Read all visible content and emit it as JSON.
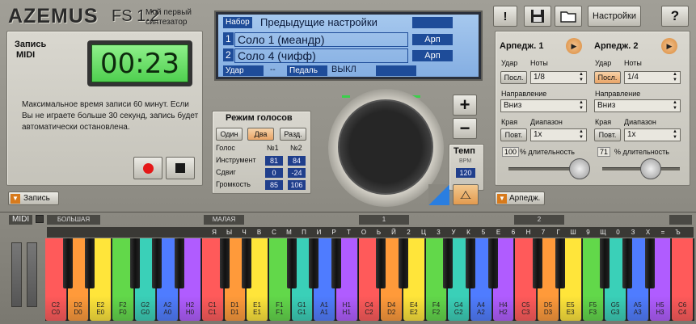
{
  "header": {
    "logo": "AZEMUS",
    "version": "FS 1.2",
    "subtitle": "Мой первый синтезатор"
  },
  "toolbar": {
    "help_label": "!",
    "settings_label": "Настройки",
    "question_label": "?",
    "save_icon": "floppy-icon",
    "folder_icon": "folder-icon"
  },
  "recording": {
    "title_line1": "Запись",
    "title_line2": "MIDI",
    "timer": "00:23",
    "info": "Максимальное время записи 60 минут. Если Вы не играете больше 30 секунд, запись будет автоматически остановлена.",
    "record_icon": "record-icon",
    "stop_icon": "stop-icon",
    "toggle_label": "Запись"
  },
  "display": {
    "preset_label": "Набор",
    "preset_value": "Предыдущие настройки",
    "slot1_num": "1",
    "slot1_name": "Соло 1 (меандр)",
    "slot1_arp": "Арп",
    "slot2_num": "2",
    "slot2_name": "Соло 4 (чифф)",
    "slot2_arp": "Арп",
    "strike_label": "Удар",
    "strike_value": "--",
    "pedal_label": "Педаль",
    "pedal_value": "ВЫКЛ"
  },
  "voices": {
    "title": "Режим голосов",
    "modes": [
      "Один",
      "Два",
      "Разд."
    ],
    "active_mode": "Два",
    "col_voice": "Голос",
    "col1": "№1",
    "col2": "№2",
    "rows": [
      {
        "label": "Инструмент",
        "v1": "81",
        "v2": "84"
      },
      {
        "label": "Сдвиг",
        "v1": "0",
        "v2": "-24"
      },
      {
        "label": "Громкость",
        "v1": "85",
        "v2": "106"
      }
    ]
  },
  "tempo": {
    "title": "Темп",
    "unit": "BPM",
    "value": "120",
    "plus": "+",
    "minus": "−",
    "metronome_icon": "metronome-icon"
  },
  "arp1": {
    "title": "Арпедж. 1",
    "strike": "Удар",
    "notes": "Ноты",
    "strike_btn": "Посл.",
    "notes_value": "1/8",
    "direction_label": "Направление",
    "direction": "Вниз",
    "edges": "Края",
    "range": "Диапазон",
    "edges_btn": "Повт.",
    "range_value": "1x",
    "pct": "100",
    "duration": "% длительность",
    "duration_fraction": 0.9
  },
  "arp2": {
    "title": "Арпедж. 2",
    "strike": "Удар",
    "notes": "Ноты",
    "strike_btn": "Посл.",
    "notes_value": "1/4",
    "direction_label": "Направление",
    "direction": "Вниз",
    "edges": "Края",
    "range": "Диапазон",
    "edges_btn": "Повт.",
    "range_value": "1x",
    "pct": "71",
    "duration": "% длительность",
    "duration_fraction": 0.71
  },
  "arp_toggle_label": "Арпедж.",
  "keyboard": {
    "midi_label": "MIDI",
    "octave_labels": [
      "БОЛЬШАЯ",
      "МАЛАЯ",
      "1",
      "2"
    ],
    "note_letters": [
      "Я",
      "Ы",
      "Ч",
      "В",
      "С",
      "М",
      "П",
      "И",
      "Р",
      "Т",
      "О",
      "Ь",
      "Й",
      "2",
      "Ц",
      "3",
      "У",
      "К",
      "5",
      "Е",
      "6",
      "Н",
      "7",
      "Г",
      "Ш",
      "9",
      "Щ",
      "0",
      "З",
      "Х",
      "=",
      "Ъ"
    ],
    "white_keys": [
      [
        "C2",
        "C0"
      ],
      [
        "D2",
        "D0"
      ],
      [
        "E2",
        "E0"
      ],
      [
        "F2",
        "F0"
      ],
      [
        "G2",
        "G0"
      ],
      [
        "A2",
        "A0"
      ],
      [
        "H2",
        "H0"
      ],
      [
        "C1",
        "C1"
      ],
      [
        "D1",
        "D1"
      ],
      [
        "E1",
        "E1"
      ],
      [
        "F1",
        "F1"
      ],
      [
        "G1",
        "G1"
      ],
      [
        "A1",
        "A1"
      ],
      [
        "H1",
        "H1"
      ],
      [
        "C4",
        "C2"
      ],
      [
        "D4",
        "D2"
      ],
      [
        "E4",
        "E2"
      ],
      [
        "F4",
        "F2"
      ],
      [
        "G4",
        "G2"
      ],
      [
        "A4",
        "A2"
      ],
      [
        "H4",
        "H2"
      ],
      [
        "C5",
        "C3"
      ],
      [
        "D5",
        "D3"
      ],
      [
        "E5",
        "E3"
      ],
      [
        "F5",
        "F3"
      ],
      [
        "G5",
        "G3"
      ],
      [
        "A5",
        "A3"
      ],
      [
        "H5",
        "H3"
      ],
      [
        "C6",
        "C4"
      ]
    ],
    "white_colors": [
      "#ff5a5a",
      "#ff9a3a",
      "#ffe53a",
      "#62d84a",
      "#3ad0b8",
      "#4f7cff",
      "#b05cff",
      "#ff5a5a",
      "#ff9a3a",
      "#ffe53a",
      "#62d84a",
      "#3ad0b8",
      "#4f7cff",
      "#b05cff",
      "#ff5a5a",
      "#ff9a3a",
      "#ffe53a",
      "#62d84a",
      "#3ad0b8",
      "#4f7cff",
      "#b05cff",
      "#ff5a5a",
      "#ff9a3a",
      "#ffe53a",
      "#62d84a",
      "#3ad0b8",
      "#4f7cff",
      "#b05cff",
      "#ff5a5a"
    ]
  }
}
